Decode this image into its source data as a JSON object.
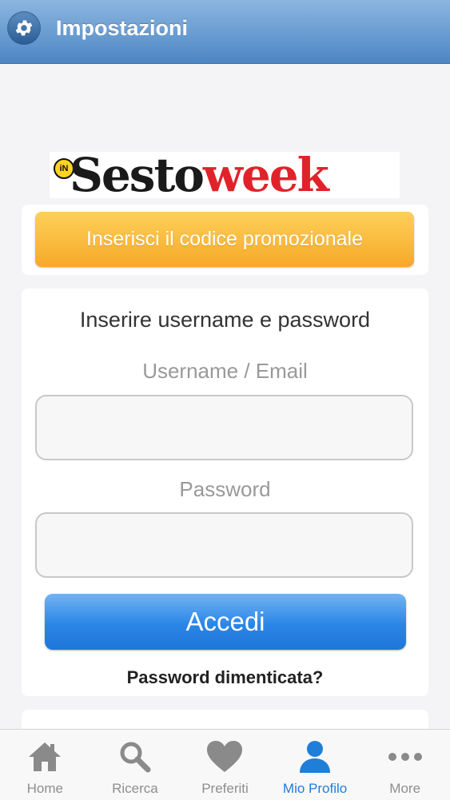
{
  "header": {
    "title": "Impostazioni",
    "settings_icon": "gear-icon"
  },
  "logo": {
    "badge": "iN",
    "part1": "Sesto",
    "part2": "week",
    "colors": {
      "black": "#1a1a1a",
      "red": "#e0232a"
    }
  },
  "promo": {
    "button_label": "Inserisci il codice promozionale"
  },
  "login": {
    "heading": "Inserire username e password",
    "username_label": "Username / Email",
    "username_value": "",
    "password_label": "Password",
    "password_value": "",
    "submit_label": "Accedi",
    "forgot_label": "Password dimenticata?"
  },
  "tabbar": {
    "active_color": "#1f7ed8",
    "items": [
      {
        "label": "Home",
        "icon": "home-icon"
      },
      {
        "label": "Ricerca",
        "icon": "search-icon"
      },
      {
        "label": "Preferiti",
        "icon": "heart-icon"
      },
      {
        "label": "Mio Profilo",
        "icon": "user-icon",
        "active": true
      },
      {
        "label": "More",
        "icon": "more-icon"
      }
    ]
  }
}
